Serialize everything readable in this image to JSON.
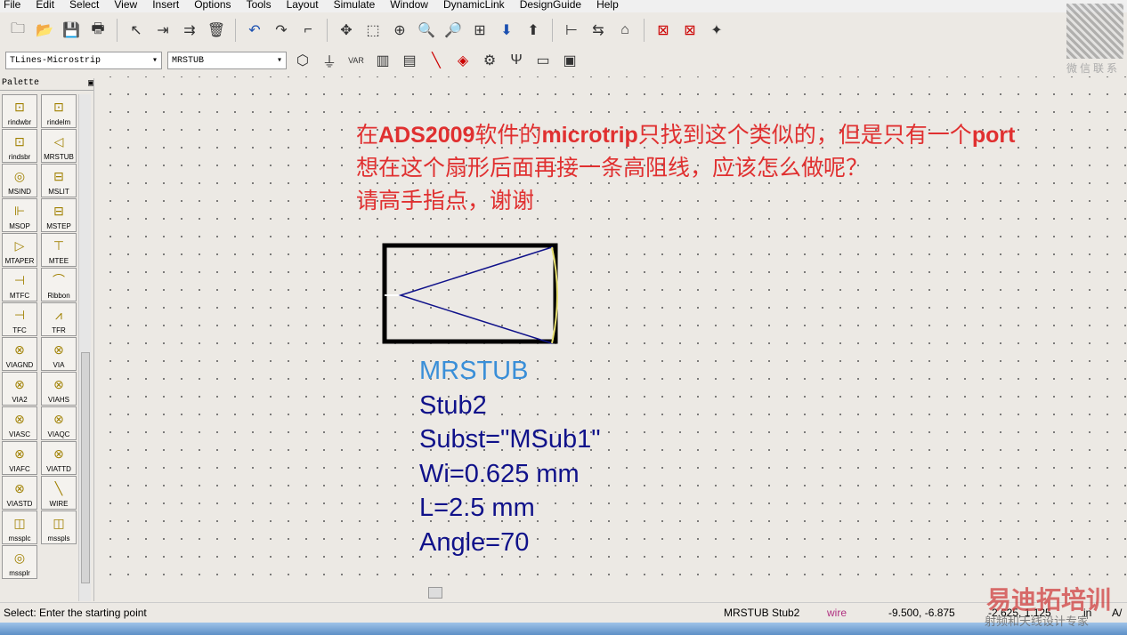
{
  "menu": [
    "File",
    "Edit",
    "Select",
    "View",
    "Insert",
    "Options",
    "Tools",
    "Layout",
    "Simulate",
    "Window",
    "DynamicLink",
    "DesignGuide",
    "Help"
  ],
  "toolbar": {
    "library": "TLines-Microstrip",
    "component": "MRSTUB"
  },
  "qr_label": "微信联系",
  "palette": {
    "title": "Palette",
    "items": [
      "rindwbr",
      "rindelm",
      "rindsbr",
      "MRSTUB",
      "MSIND",
      "MSLIT",
      "MSOP",
      "MSTEP",
      "MTAPER",
      "MTEE",
      "MTFC",
      "Ribbon",
      "TFC",
      "TFR",
      "VIAGND",
      "VIA",
      "VIA2",
      "VIAHS",
      "VIASC",
      "VIAQC",
      "VIAFC",
      "VIATTD",
      "VIASTD",
      "WIRE",
      "mssplc",
      "msspls",
      "mssplr"
    ]
  },
  "note": {
    "l1a": "在",
    "l1b": "ADS2009",
    "l1c": "软件的",
    "l1d": "microtrip",
    "l1e": "只找到这个类似的，但是只有一个",
    "l1f": "port",
    "line2": "想在这个扇形后面再接一条高阻线，应该怎么做呢？",
    "line3": "请高手指点，谢谢"
  },
  "component": {
    "type": "MRSTUB",
    "name": "Stub2",
    "subst": "Subst=\"MSub1\"",
    "wi": "Wi=0.625 mm",
    "l": "L=2.5 mm",
    "angle": "Angle=70"
  },
  "status": {
    "prompt": "Select: Enter the starting point",
    "selection": "MRSTUB Stub2",
    "mode": "wire",
    "coords1": "-9.500, -6.875",
    "coords2": "-2.625, 1.125",
    "unit": "in",
    "extra": "A/"
  },
  "watermark": {
    "brand": "易迪拓培训",
    "tagline": "射频和天线设计专家"
  }
}
